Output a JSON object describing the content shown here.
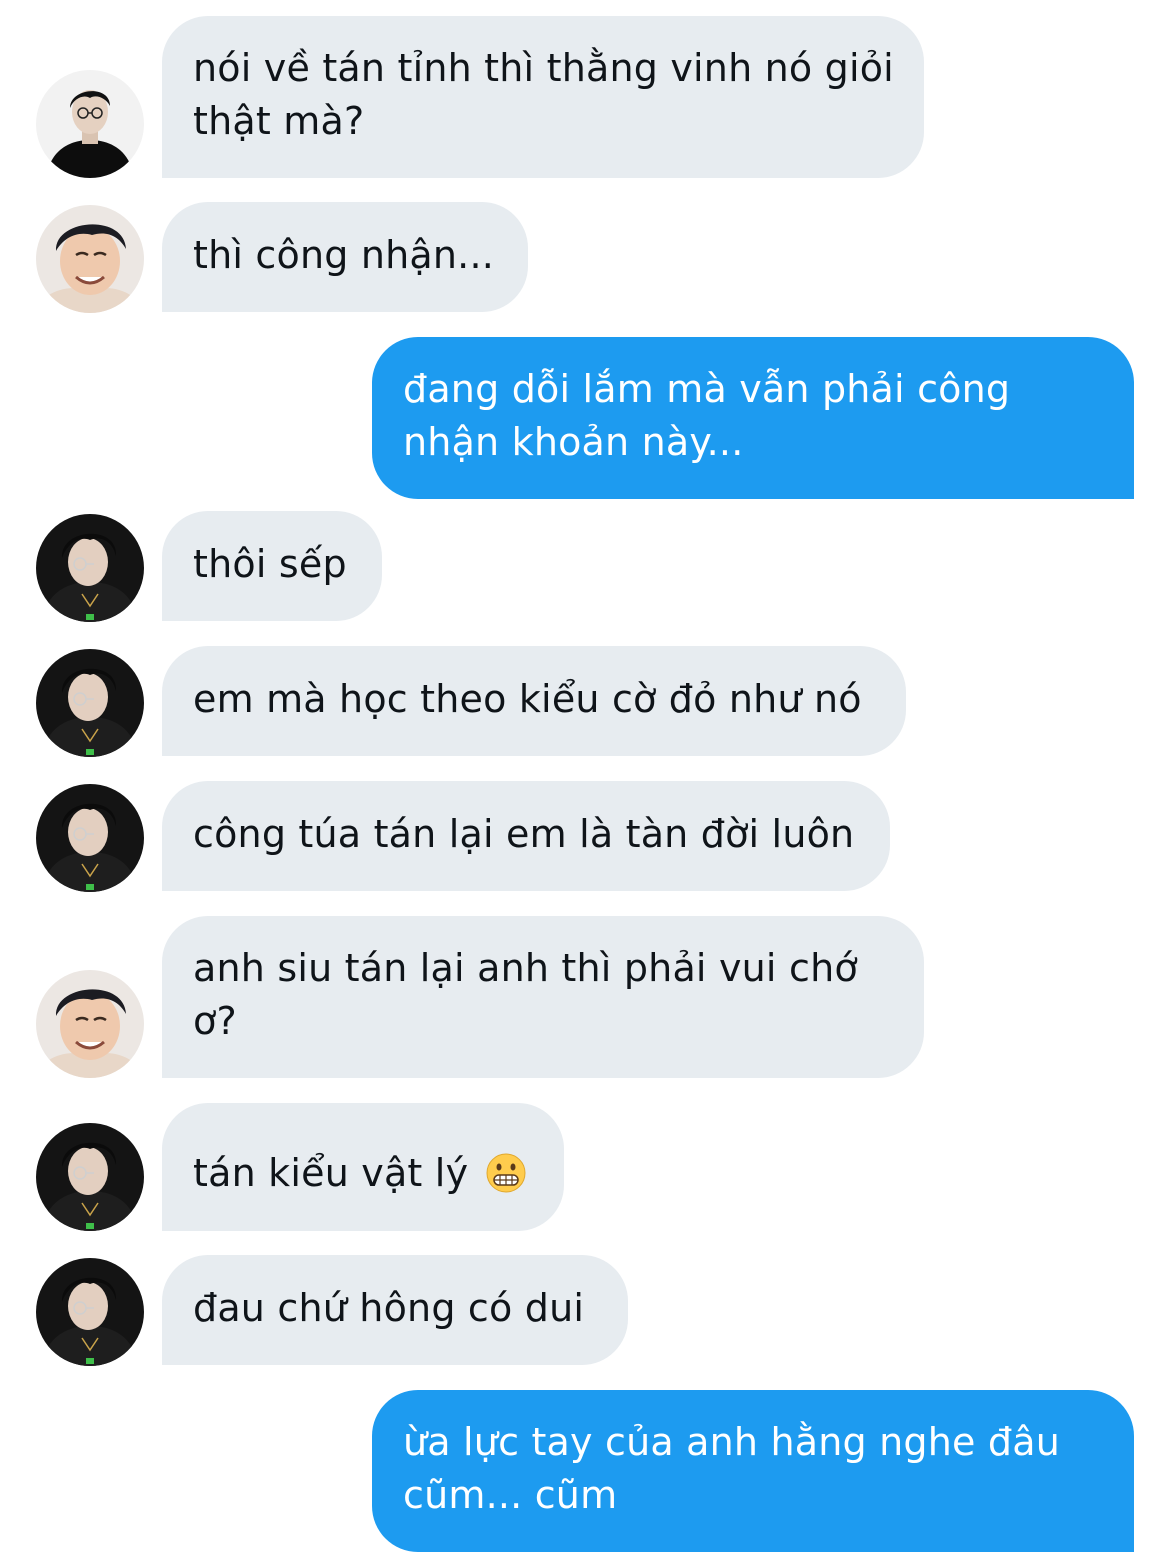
{
  "conversation": {
    "messages": [
      {
        "sender": "other",
        "avatar": "avatar-boy-black-sweater",
        "text": "nói về tán tỉnh thì thằng vinh nó giỏi thật mà?"
      },
      {
        "sender": "other",
        "avatar": "avatar-boy-smiling",
        "text": "thì công nhận..."
      },
      {
        "sender": "me",
        "text": "đang dỗi lắm mà vẫn phải công nhận khoản này..."
      },
      {
        "sender": "other",
        "avatar": "avatar-boy-glasses-hoodie",
        "text": "thôi sếp"
      },
      {
        "sender": "other",
        "avatar": "avatar-boy-glasses-hoodie",
        "text": "em mà học theo kiểu cờ đỏ như nó"
      },
      {
        "sender": "other",
        "avatar": "avatar-boy-glasses-hoodie",
        "text": "công túa tán lại em là tàn đời luôn"
      },
      {
        "sender": "other",
        "avatar": "avatar-boy-smiling",
        "text": "anh siu tán lại anh thì phải vui chớ ơ?"
      },
      {
        "sender": "other",
        "avatar": "avatar-boy-glasses-hoodie",
        "text": "tán kiểu vật lý",
        "emoji": "grimacing-face-icon"
      },
      {
        "sender": "other",
        "avatar": "avatar-boy-glasses-hoodie",
        "text": "đau chứ hông có dui"
      },
      {
        "sender": "me",
        "text": "ừa lực tay của anh hằng nghe đâu cũm... cũm"
      }
    ]
  },
  "colors": {
    "incoming_bubble": "#e7ecf0",
    "outgoing_bubble": "#1d9bf0",
    "incoming_text": "#0f1419",
    "outgoing_text": "#ffffff"
  }
}
